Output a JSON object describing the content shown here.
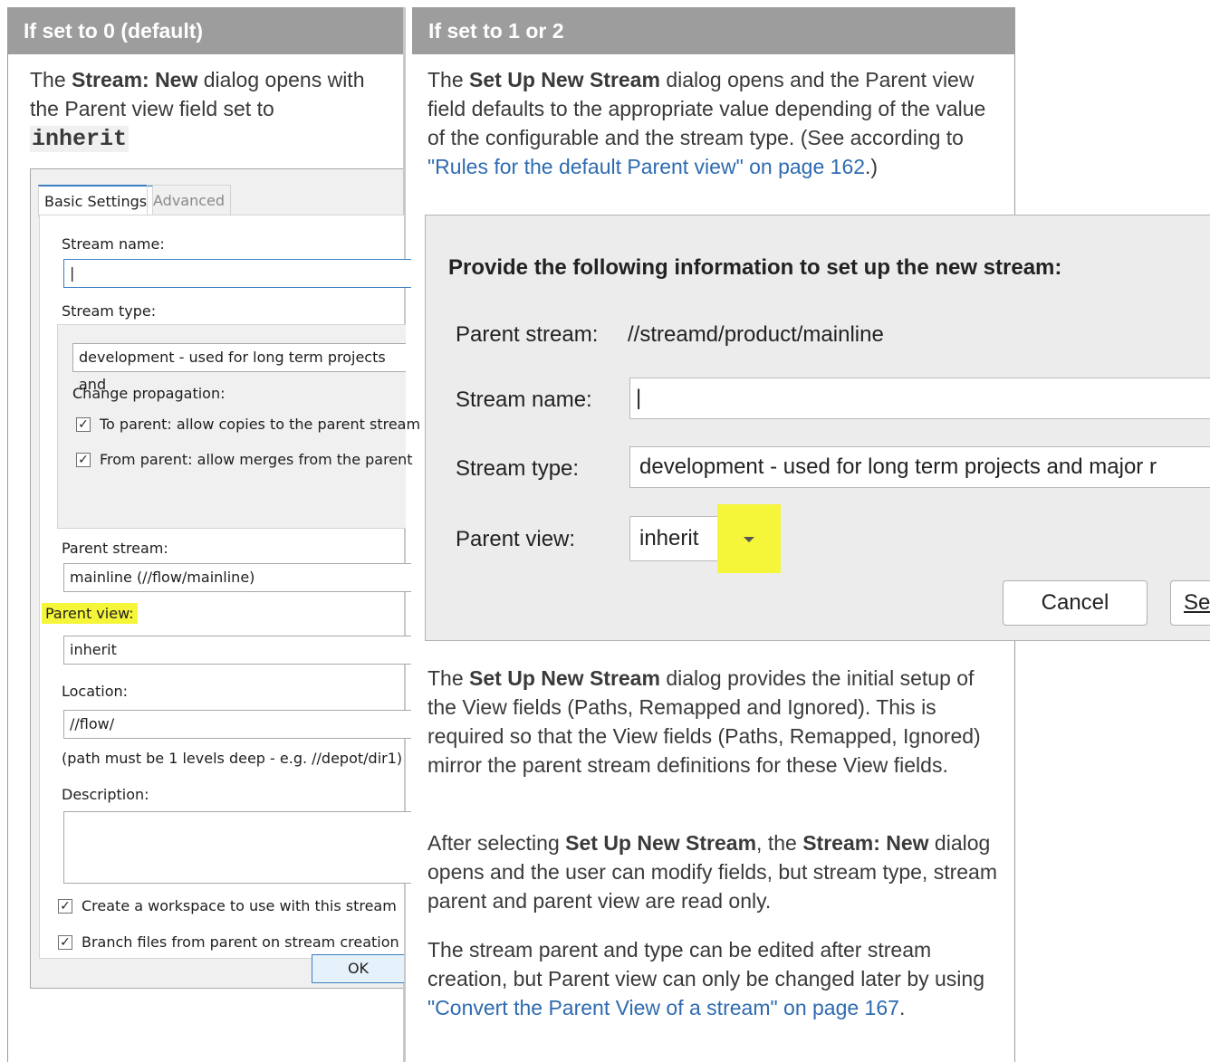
{
  "left_col": {
    "header": "If set to 0 (default)",
    "intro": {
      "pre": "The ",
      "bold": "Stream: New",
      "mid": " dialog opens with the Parent view field set to",
      "code": "inherit"
    },
    "dialog": {
      "tabs": [
        "Basic Settings",
        "Advanced"
      ],
      "stream_name_label": "Stream name:",
      "stream_name_value": "|",
      "stream_type_label": "Stream type:",
      "stream_type_value": "development - used for long term projects and",
      "change_propagation_label": "Change propagation:",
      "to_parent_label": "To parent: allow copies to the parent stream",
      "from_parent_label": "From parent: allow merges from the parent",
      "parent_stream_label": "Parent stream:",
      "parent_stream_value": "mainline (//flow/mainline)",
      "parent_view_label": "Parent view:",
      "parent_view_value": "inherit",
      "location_label": "Location:",
      "location_value": "//flow/",
      "location_hint": "(path must be 1 levels deep - e.g. //depot/dir1)",
      "description_label": "Description:",
      "create_workspace_label": "Create a workspace to use with this stream",
      "branch_files_label": "Branch files from parent on stream creation",
      "ok_label": "OK",
      "checkmark": "✓"
    }
  },
  "right_col": {
    "header": "If set to 1 or 2",
    "intro": {
      "pre": "The ",
      "bold": "Set Up New Stream",
      "mid": " dialog opens and the Parent view field defaults to the appropriate value depending of the value of the configurable and the stream type. (See according to ",
      "link": "\"Rules for the default Parent view\" on page 162",
      "post": ".)"
    },
    "dialog": {
      "heading": "Provide the following information to set up the new stream:",
      "parent_stream_label": "Parent stream:",
      "parent_stream_value": "//streamd/product/mainline",
      "stream_name_label": "Stream name:",
      "stream_name_value": "|",
      "stream_type_label": "Stream type:",
      "stream_type_value": "development - used for long term projects and major r",
      "parent_view_label": "Parent view:",
      "parent_view_value": "inherit",
      "cancel_label": "Cancel",
      "setup_label_partial": "Se"
    },
    "para2": {
      "pre": "The ",
      "bold": "Set Up New Stream",
      "post": " dialog provides the initial setup of the View fields (Paths, Remapped and Ignored). This is required so that the View fields (Paths, Remapped, Ignored) mirror the parent stream definitions for these View fields."
    },
    "para3": {
      "pre": "After selecting ",
      "bold1": "Set Up New Stream",
      "mid": ", the ",
      "bold2": "Stream: New",
      "post": " dialog opens and the user can modify fields, but stream type, stream parent and parent view are read only."
    },
    "para4": {
      "pre": "The stream parent and type can be edited after stream creation, but Parent view can only be changed later by using ",
      "link": "\"Convert the Parent View of a stream\" on page 167",
      "post": "."
    }
  },
  "colors": {
    "header_bg": "#9d9d9d",
    "highlight": "#f5f53a",
    "link": "#2e6bb0"
  }
}
